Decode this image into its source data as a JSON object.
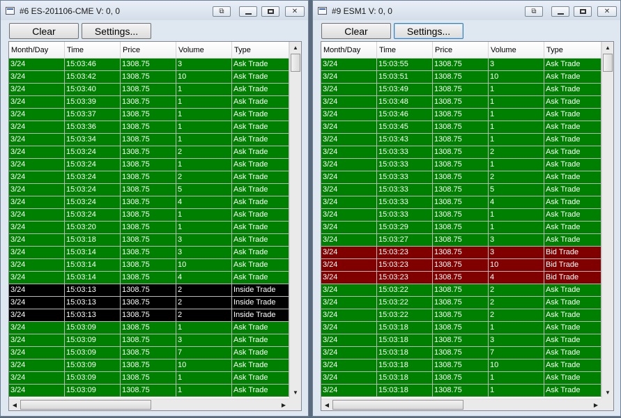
{
  "colors": {
    "ask": "#008000",
    "bid": "#800000",
    "inside": "#000000"
  },
  "columns": [
    "Month/Day",
    "Time",
    "Price",
    "Volume",
    "Type"
  ],
  "icons": {
    "app": "app-window-icon",
    "special": "pin-window-icon",
    "minimize": "minimize-icon",
    "maximize": "maximize-icon",
    "close": "close-icon",
    "scroll_up": "scroll-up-arrow-icon",
    "scroll_down": "scroll-down-arrow-icon",
    "scroll_left": "scroll-left-arrow-icon",
    "scroll_right": "scroll-right-arrow-icon"
  },
  "windows": [
    {
      "title": "#6 ES-201106-CME  V: 0, 0",
      "clear_label": "Clear",
      "settings_label": "Settings...",
      "rows": [
        [
          "3/24",
          "15:03:46",
          "1308.75",
          "3",
          "Ask Trade"
        ],
        [
          "3/24",
          "15:03:42",
          "1308.75",
          "10",
          "Ask Trade"
        ],
        [
          "3/24",
          "15:03:40",
          "1308.75",
          "1",
          "Ask Trade"
        ],
        [
          "3/24",
          "15:03:39",
          "1308.75",
          "1",
          "Ask Trade"
        ],
        [
          "3/24",
          "15:03:37",
          "1308.75",
          "1",
          "Ask Trade"
        ],
        [
          "3/24",
          "15:03:36",
          "1308.75",
          "1",
          "Ask Trade"
        ],
        [
          "3/24",
          "15:03:34",
          "1308.75",
          "1",
          "Ask Trade"
        ],
        [
          "3/24",
          "15:03:24",
          "1308.75",
          "2",
          "Ask Trade"
        ],
        [
          "3/24",
          "15:03:24",
          "1308.75",
          "1",
          "Ask Trade"
        ],
        [
          "3/24",
          "15:03:24",
          "1308.75",
          "2",
          "Ask Trade"
        ],
        [
          "3/24",
          "15:03:24",
          "1308.75",
          "5",
          "Ask Trade"
        ],
        [
          "3/24",
          "15:03:24",
          "1308.75",
          "4",
          "Ask Trade"
        ],
        [
          "3/24",
          "15:03:24",
          "1308.75",
          "1",
          "Ask Trade"
        ],
        [
          "3/24",
          "15:03:20",
          "1308.75",
          "1",
          "Ask Trade"
        ],
        [
          "3/24",
          "15:03:18",
          "1308.75",
          "3",
          "Ask Trade"
        ],
        [
          "3/24",
          "15:03:14",
          "1308.75",
          "3",
          "Ask Trade"
        ],
        [
          "3/24",
          "15:03:14",
          "1308.75",
          "10",
          "Ask Trade"
        ],
        [
          "3/24",
          "15:03:14",
          "1308.75",
          "4",
          "Ask Trade"
        ],
        [
          "3/24",
          "15:03:13",
          "1308.75",
          "2",
          "Inside Trade"
        ],
        [
          "3/24",
          "15:03:13",
          "1308.75",
          "2",
          "Inside Trade"
        ],
        [
          "3/24",
          "15:03:13",
          "1308.75",
          "2",
          "Inside Trade"
        ],
        [
          "3/24",
          "15:03:09",
          "1308.75",
          "1",
          "Ask Trade"
        ],
        [
          "3/24",
          "15:03:09",
          "1308.75",
          "3",
          "Ask Trade"
        ],
        [
          "3/24",
          "15:03:09",
          "1308.75",
          "7",
          "Ask Trade"
        ],
        [
          "3/24",
          "15:03:09",
          "1308.75",
          "10",
          "Ask Trade"
        ],
        [
          "3/24",
          "15:03:09",
          "1308.75",
          "1",
          "Ask Trade"
        ],
        [
          "3/24",
          "15:03:09",
          "1308.75",
          "1",
          "Ask Trade"
        ]
      ]
    },
    {
      "title": "#9 ESM1  V: 0, 0",
      "clear_label": "Clear",
      "settings_label": "Settings...",
      "rows": [
        [
          "3/24",
          "15:03:55",
          "1308.75",
          "3",
          "Ask Trade"
        ],
        [
          "3/24",
          "15:03:51",
          "1308.75",
          "10",
          "Ask Trade"
        ],
        [
          "3/24",
          "15:03:49",
          "1308.75",
          "1",
          "Ask Trade"
        ],
        [
          "3/24",
          "15:03:48",
          "1308.75",
          "1",
          "Ask Trade"
        ],
        [
          "3/24",
          "15:03:46",
          "1308.75",
          "1",
          "Ask Trade"
        ],
        [
          "3/24",
          "15:03:45",
          "1308.75",
          "1",
          "Ask Trade"
        ],
        [
          "3/24",
          "15:03:43",
          "1308.75",
          "1",
          "Ask Trade"
        ],
        [
          "3/24",
          "15:03:33",
          "1308.75",
          "2",
          "Ask Trade"
        ],
        [
          "3/24",
          "15:03:33",
          "1308.75",
          "1",
          "Ask Trade"
        ],
        [
          "3/24",
          "15:03:33",
          "1308.75",
          "2",
          "Ask Trade"
        ],
        [
          "3/24",
          "15:03:33",
          "1308.75",
          "5",
          "Ask Trade"
        ],
        [
          "3/24",
          "15:03:33",
          "1308.75",
          "4",
          "Ask Trade"
        ],
        [
          "3/24",
          "15:03:33",
          "1308.75",
          "1",
          "Ask Trade"
        ],
        [
          "3/24",
          "15:03:29",
          "1308.75",
          "1",
          "Ask Trade"
        ],
        [
          "3/24",
          "15:03:27",
          "1308.75",
          "3",
          "Ask Trade"
        ],
        [
          "3/24",
          "15:03:23",
          "1308.75",
          "3",
          "Bid Trade"
        ],
        [
          "3/24",
          "15:03:23",
          "1308.75",
          "10",
          "Bid Trade"
        ],
        [
          "3/24",
          "15:03:23",
          "1308.75",
          "4",
          "Bid Trade"
        ],
        [
          "3/24",
          "15:03:22",
          "1308.75",
          "2",
          "Ask Trade"
        ],
        [
          "3/24",
          "15:03:22",
          "1308.75",
          "2",
          "Ask Trade"
        ],
        [
          "3/24",
          "15:03:22",
          "1308.75",
          "2",
          "Ask Trade"
        ],
        [
          "3/24",
          "15:03:18",
          "1308.75",
          "1",
          "Ask Trade"
        ],
        [
          "3/24",
          "15:03:18",
          "1308.75",
          "3",
          "Ask Trade"
        ],
        [
          "3/24",
          "15:03:18",
          "1308.75",
          "7",
          "Ask Trade"
        ],
        [
          "3/24",
          "15:03:18",
          "1308.75",
          "10",
          "Ask Trade"
        ],
        [
          "3/24",
          "15:03:18",
          "1308.75",
          "1",
          "Ask Trade"
        ],
        [
          "3/24",
          "15:03:18",
          "1308.75",
          "1",
          "Ask Trade"
        ]
      ]
    }
  ]
}
